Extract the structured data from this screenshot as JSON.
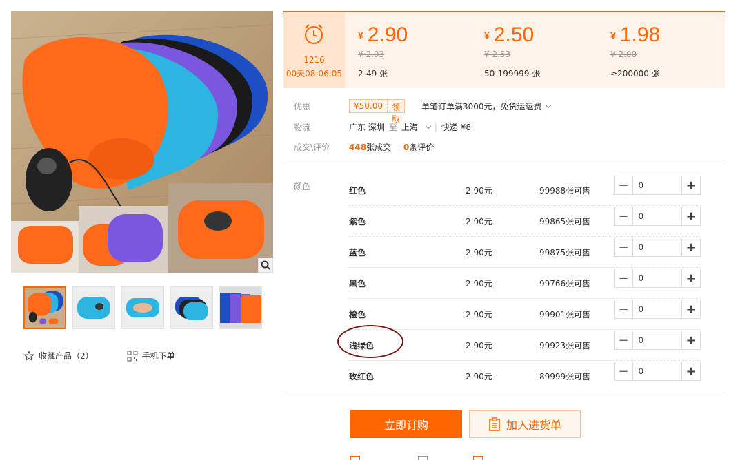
{
  "gallery": {
    "thumb_count": 5,
    "actions": [
      {
        "icon": "star-icon",
        "label": "收藏产品（2）"
      },
      {
        "icon": "qr-code-icon",
        "label": "手机下单"
      }
    ]
  },
  "countdown": {
    "icon": "alarm-clock-icon",
    "date": "1216",
    "time": "00天08:06:05"
  },
  "price_tiers": [
    {
      "currency": "¥",
      "price": "2.90",
      "old_price": "¥ 2.93",
      "range": "2-49 张"
    },
    {
      "currency": "¥",
      "price": "2.50",
      "old_price": "¥ 2.53",
      "range": "50-199999 张"
    },
    {
      "currency": "¥",
      "price": "1.98",
      "old_price": "¥ 2.00",
      "range": "≥200000 张"
    }
  ],
  "discount": {
    "label": "优惠",
    "coupon_amount": "¥50.00",
    "coupon_action": "领取",
    "promo_text": "单笔订单满3000元，免货运运费"
  },
  "logistics": {
    "label": "物流",
    "from": "广东 深圳",
    "to_word": "至",
    "destination": "上海",
    "courier": "快递 ¥8"
  },
  "deals": {
    "label": "成交\\评价",
    "sold_count": "448",
    "sold_suffix": "张成交",
    "review_count": "0",
    "review_suffix": "条评价"
  },
  "sku": {
    "label": "颜色",
    "rows": [
      {
        "name": "红色",
        "price": "2.90元",
        "stock": "99988张可售",
        "qty": "0"
      },
      {
        "name": "紫色",
        "price": "2.90元",
        "stock": "99865张可售",
        "qty": "0"
      },
      {
        "name": "蓝色",
        "price": "2.90元",
        "stock": "99875张可售",
        "qty": "0"
      },
      {
        "name": "黑色",
        "price": "2.90元",
        "stock": "99766张可售",
        "qty": "0"
      },
      {
        "name": "橙色",
        "price": "2.90元",
        "stock": "99901张可售",
        "qty": "0"
      },
      {
        "name": "浅绿色",
        "price": "2.90元",
        "stock": "99923张可售",
        "qty": "0"
      },
      {
        "name": "玫红色",
        "price": "2.90元",
        "stock": "89999张可售",
        "qty": "0"
      }
    ],
    "minus_symbol": "−",
    "plus_symbol": "+"
  },
  "actions": {
    "buy_label": "立即订购",
    "cart_label": "加入进货单"
  },
  "colors": {
    "accent": "#ff6600",
    "band": "#fff2e8",
    "annotation": "#7a1515"
  }
}
